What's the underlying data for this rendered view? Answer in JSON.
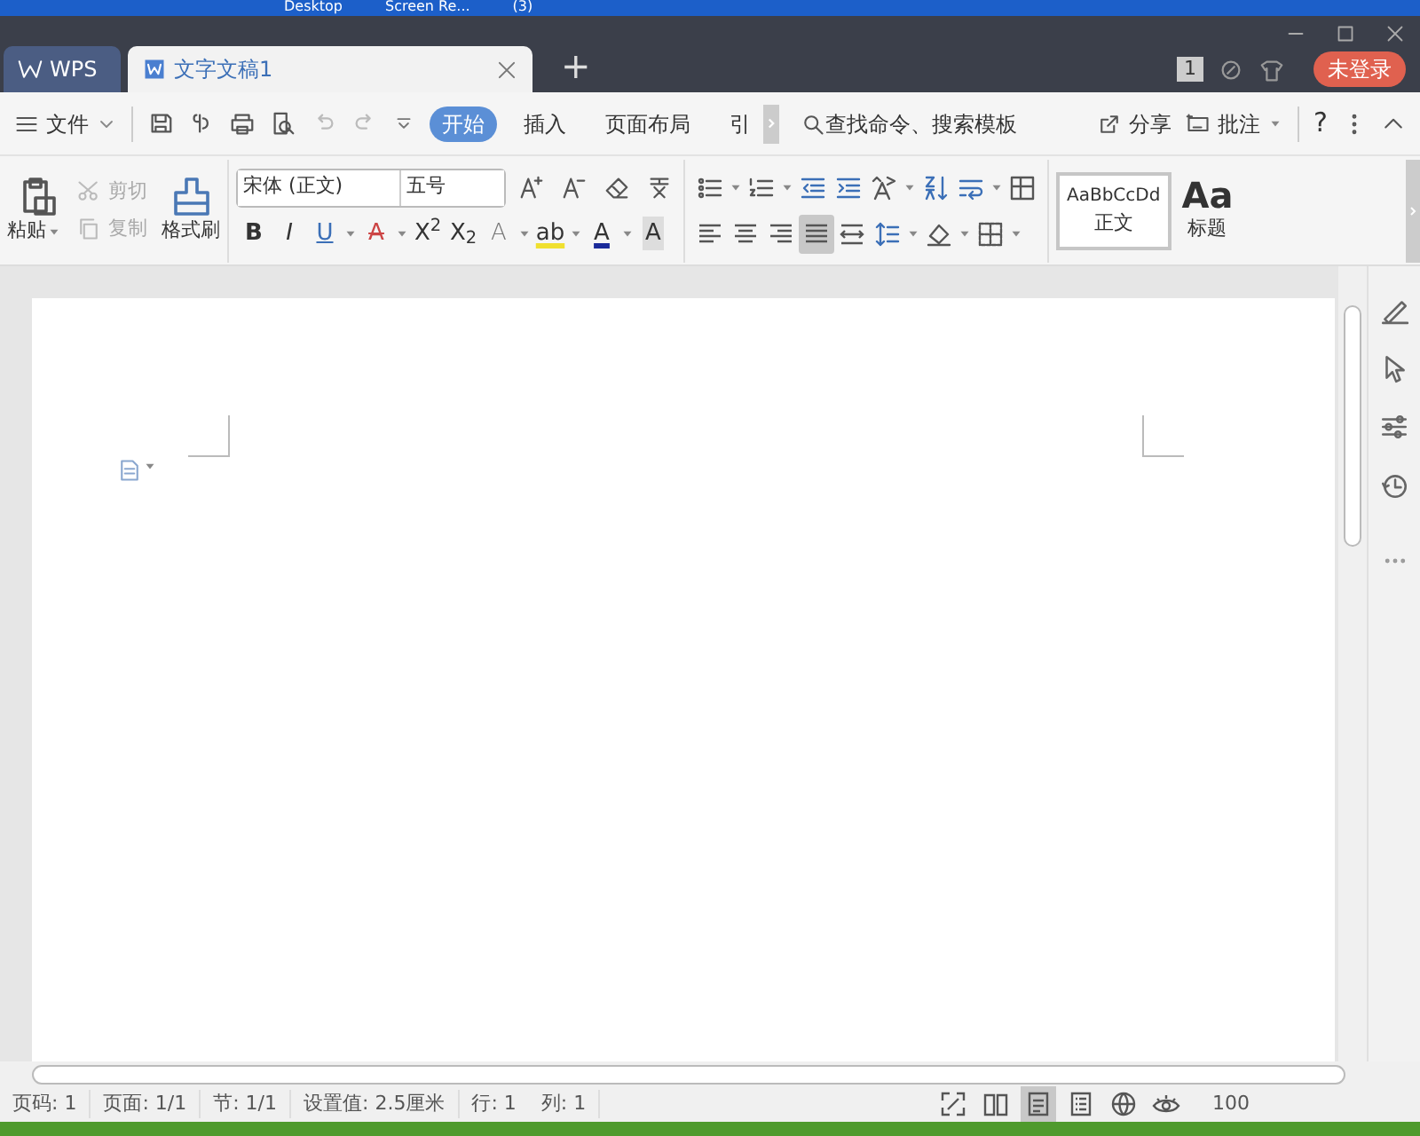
{
  "taskbar": {
    "items": [
      "Desktop",
      "Screen Re...",
      "(3)"
    ]
  },
  "title_bar": {
    "app_tab": "WPS",
    "document_tab": "文字文稿1",
    "new_tab": "+",
    "badge": "1",
    "login": "未登录"
  },
  "menu_bar": {
    "file": "文件",
    "tabs": [
      {
        "label": "开始",
        "selected": true
      },
      {
        "label": "插入",
        "selected": false
      },
      {
        "label": "页面布局",
        "selected": false
      },
      {
        "label": "引",
        "selected": false
      }
    ],
    "search": "查找命令、搜索模板",
    "share": "分享",
    "comment": "批注",
    "help": "?"
  },
  "clipboard": {
    "paste": "粘贴",
    "cut": {
      "label": "剪切",
      "disabled": true
    },
    "copy": {
      "label": "复制",
      "disabled": true
    },
    "format_painter": "格式刷"
  },
  "font": {
    "name": "宋体 (正文)",
    "size": "五号",
    "buttons": [
      {
        "kind": "bold",
        "label": "B",
        "dropdown": false
      },
      {
        "kind": "italic",
        "label": "I",
        "dropdown": false
      },
      {
        "kind": "underline",
        "label": "U",
        "dropdown": true
      },
      {
        "kind": "strike",
        "label": "A",
        "dropdown": true
      },
      {
        "kind": "superscript",
        "label": "X$^{2}$",
        "dropdown": false
      },
      {
        "kind": "subscript",
        "label": "X$_{2}$",
        "dropdown": false
      },
      {
        "kind": "effect",
        "label": "A",
        "dropdown": true
      },
      {
        "kind": "highlight",
        "label": "ab",
        "dropdown": true
      },
      {
        "kind": "color",
        "label": "A",
        "dropdown": true
      },
      {
        "kind": "shade",
        "label": "A",
        "dropdown": false
      }
    ]
  },
  "alignment": [
    {
      "selected": false
    },
    {
      "selected": false
    },
    {
      "selected": false
    },
    {
      "selected": true
    },
    {
      "selected": false
    }
  ],
  "styles": [
    {
      "preview": "AaBbCcDd",
      "label": "正文",
      "selected": true
    },
    {
      "preview": "Aa",
      "label": "标题",
      "selected": false
    }
  ],
  "status_bar": {
    "items": [
      "页码: 1",
      "页面: 1/1",
      "节: 1/1",
      "设置值: 2.5厘米",
      "行: 1",
      "列: 1"
    ],
    "views": [
      {
        "selected": false
      },
      {
        "selected": false
      },
      {
        "selected": true
      },
      {
        "selected": false
      },
      {
        "selected": false
      },
      {
        "selected": false
      }
    ],
    "zoom": "100"
  }
}
